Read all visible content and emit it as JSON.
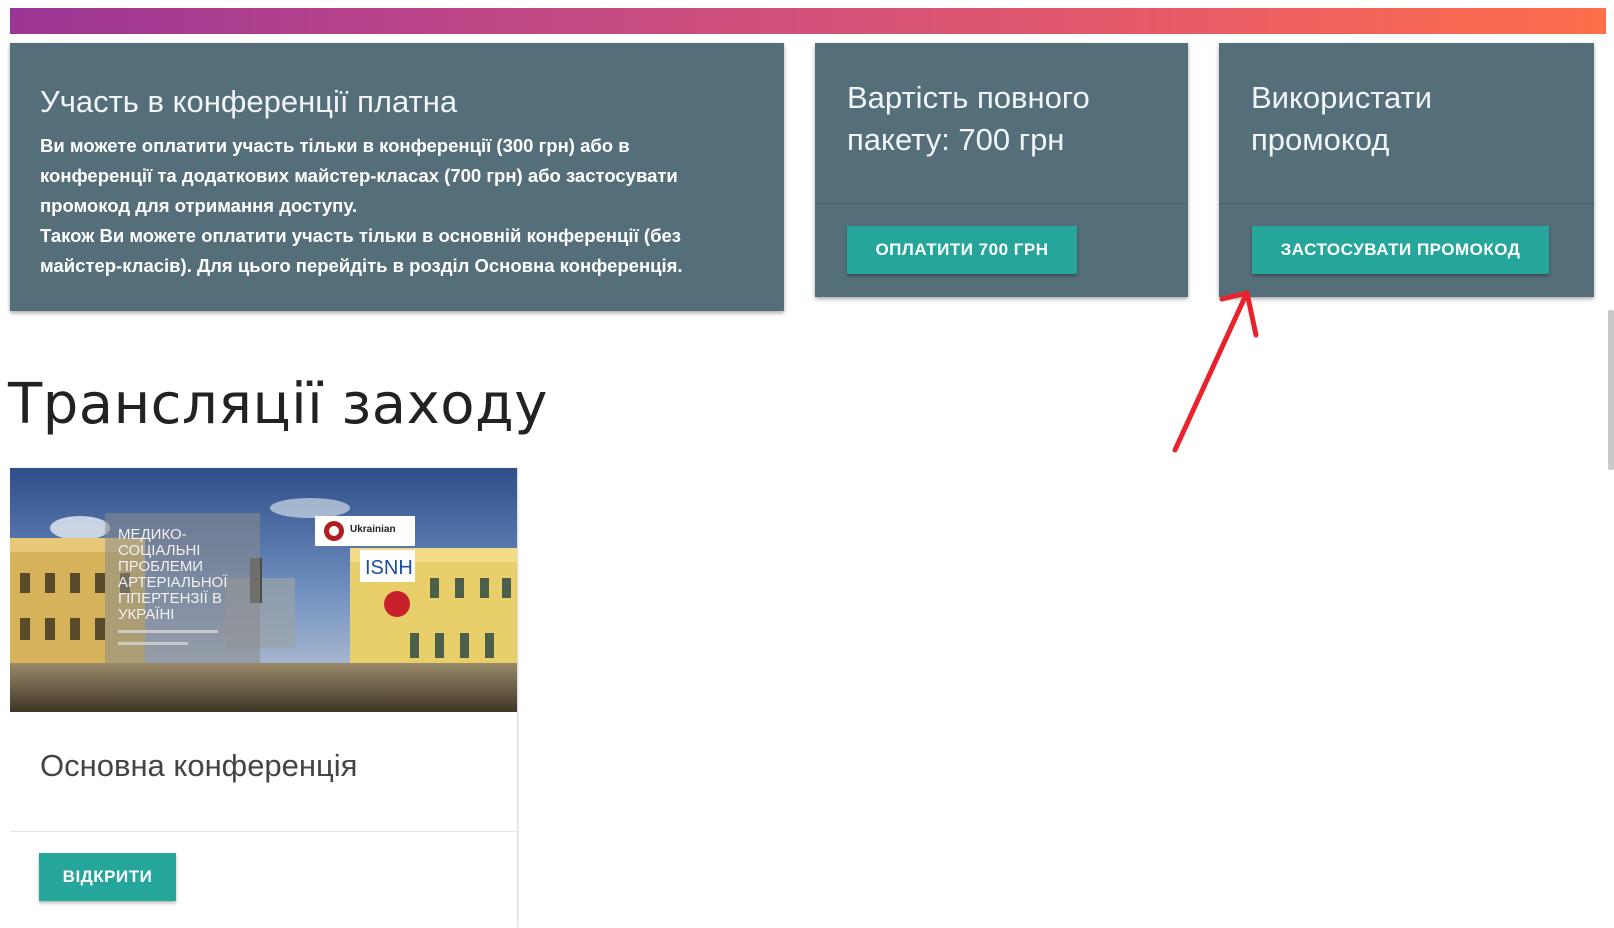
{
  "info_panel": {
    "title": "Участь в конференції платна",
    "lines": [
      "Ви можете оплатити участь тільки в конференції (300 грн) або в",
      "конференції та додаткових майстер-класах (700 грн) або застосувати",
      "промокод для отримання доступу.",
      "Також Ви можете оплатити участь тільки в основній конференції (без",
      "майстер-класів). Для цього перейдіть в розділ Основна конференція."
    ]
  },
  "price_panel": {
    "title_line1": "Вартість повного",
    "title_line2": "пакету: 700 грн",
    "button_label": "ОПЛАТИТИ 700 ГРН"
  },
  "promo_panel": {
    "title_line1": "Використати",
    "title_line2": "промокод",
    "button_label": "ЗАСТОСУВАТИ ПРОМОКОД"
  },
  "section": {
    "title": "Трансляції заходу"
  },
  "stream_card": {
    "image": {
      "poster_lines": [
        "МЕДИКО-",
        "СОЦІАЛЬНІ",
        "ПРОБЛЕМИ",
        "АРТЕРІАЛЬНОЇ",
        "ГІПЕРТЕНЗІЇ В",
        "УКРАЇНІ"
      ],
      "logo_ukrainian": "Ukrainian",
      "logo_isnh": "ISNH"
    },
    "title": "Основна конференція",
    "button_label": "ВІДКРИТИ"
  },
  "colors": {
    "panel": "#546e7a",
    "button": "#26a69a",
    "arrow": "#e8232d",
    "gradient_start": "#9c3596",
    "gradient_end": "#ff6e4a"
  }
}
